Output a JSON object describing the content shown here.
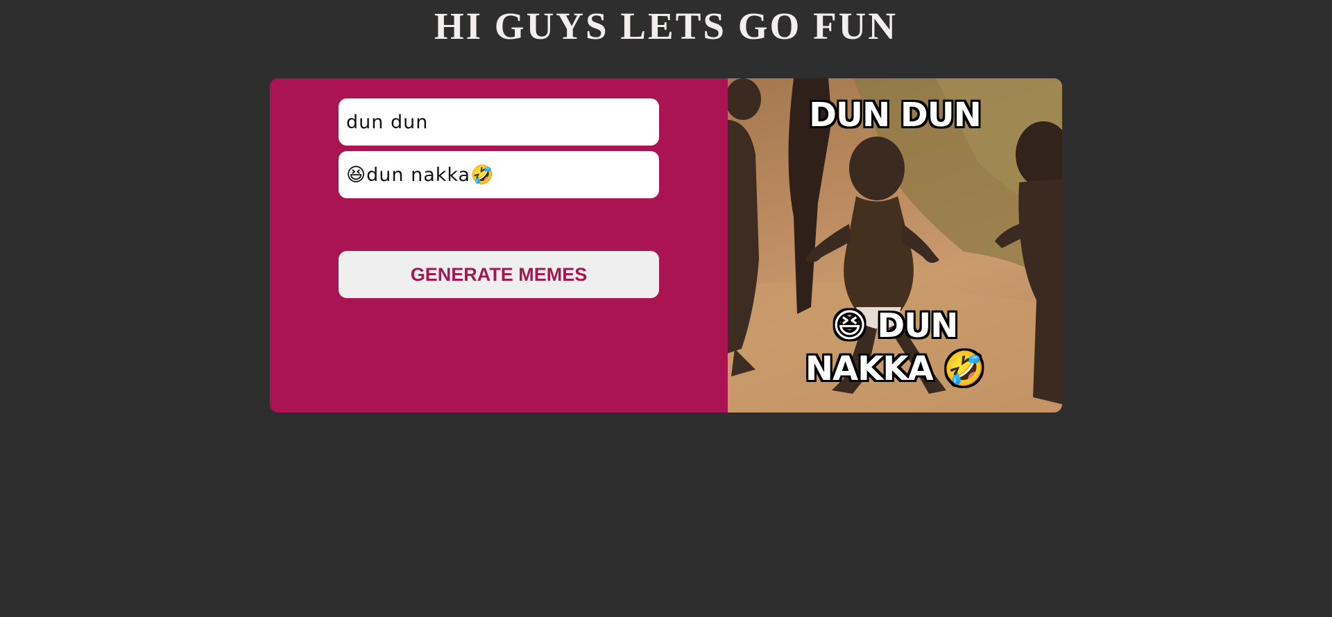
{
  "header": {
    "title": "HI GUYS LETS GO FUN"
  },
  "form": {
    "top_text": {
      "value": "dun dun",
      "placeholder": ""
    },
    "bottom_text": {
      "value": "😆dun nakka🤣",
      "placeholder": ""
    },
    "generate_label": "GENERATE MEMES"
  },
  "meme": {
    "top_caption": "DUN DUN",
    "bottom_caption_line1": "😆 DUN",
    "bottom_caption_line2": "NAKKA 🤣"
  },
  "colors": {
    "background": "#2e2e2e",
    "panel": "#ab1452",
    "button_text": "#a81650"
  }
}
